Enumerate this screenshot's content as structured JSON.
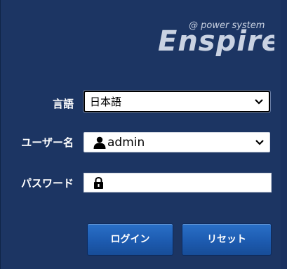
{
  "logo": {
    "tagline": "@ power system",
    "name": "Enspire"
  },
  "form": {
    "language": {
      "label": "言語",
      "value": "日本語"
    },
    "username": {
      "label": "ユーザー名",
      "value": "admin"
    },
    "password": {
      "label": "パスワード",
      "value": ""
    }
  },
  "buttons": {
    "login": "ログイン",
    "reset": "リセット"
  },
  "icons": {
    "user": "user-icon",
    "lock": "lock-icon",
    "dropdown": "chevron-down-icon"
  },
  "colors": {
    "background": "#1c3563",
    "button": "#1d5bb0",
    "logo": "#c9d2e2"
  }
}
